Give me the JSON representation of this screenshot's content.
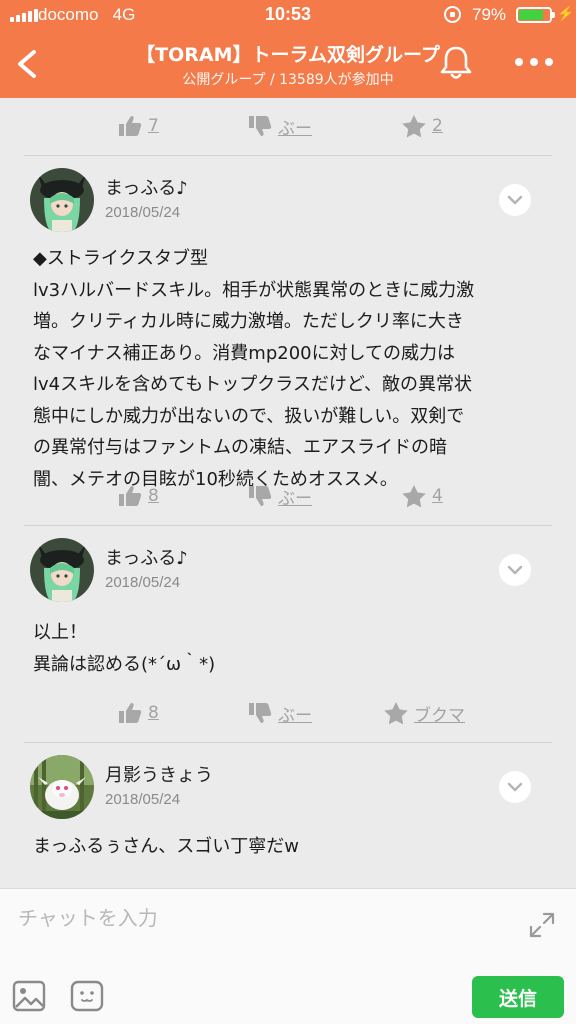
{
  "status_bar": {
    "carrier": "docomo",
    "network": "4G",
    "time": "10:53",
    "battery_percent": "79%",
    "battery_level": 0.79,
    "battery_color": "#43d23f"
  },
  "header": {
    "title": "【TORAM】トーラム双剣グループ",
    "subtitle": "公開グループ / 13589人が参加中",
    "background_color": "#f47a4a"
  },
  "icons": {
    "back": "chevron-left-icon",
    "notifications": "bell-icon",
    "more": "more-dots-icon",
    "like": "thumbs-up-icon",
    "boo": "thumbs-down-icon",
    "star": "star-icon",
    "post_menu": "chevron-down-icon",
    "expand": "expand-icon",
    "image": "image-icon",
    "sticker": "sticker-icon"
  },
  "feed": {
    "top_reactions": {
      "likes": "7",
      "boo": "ぶー",
      "stars": "2"
    },
    "posts": [
      {
        "author": "まっふる♪",
        "date": "2018/05/24",
        "lines": [
          "◆ストライクスタブ型",
          "lv3ハルバードスキル。相手が状態異常のときに威力激",
          "増。クリティカル時に威力激増。ただしクリ率に大き",
          "なマイナス補正あり。消費mp200に対しての威力は",
          "lv4スキルを含めてもトップクラスだけど、敵の異常状",
          "態中にしか威力が出ないので、扱いが難しい。双剣で",
          "の異常付与はファントムの凍結、エアスライドの暗",
          "闇、メテオの目眩が10秒続くためオススメ。"
        ],
        "reactions": {
          "likes": "8",
          "boo": "ぶー",
          "stars": "4"
        }
      },
      {
        "author": "まっふる♪",
        "date": "2018/05/24",
        "lines": [
          "以上！",
          "異論は認める(*´ω｀*)"
        ],
        "reactions": {
          "likes": "8",
          "boo": "ぶー",
          "bookmark": "ブクマ"
        }
      },
      {
        "author": "月影うきょう",
        "date": "2018/05/24",
        "lines": [
          "まっふるぅさん、スゴい丁寧だw"
        ]
      }
    ]
  },
  "composer": {
    "placeholder": "チャットを入力",
    "send_label": "送信",
    "send_color": "#2bc04e"
  }
}
